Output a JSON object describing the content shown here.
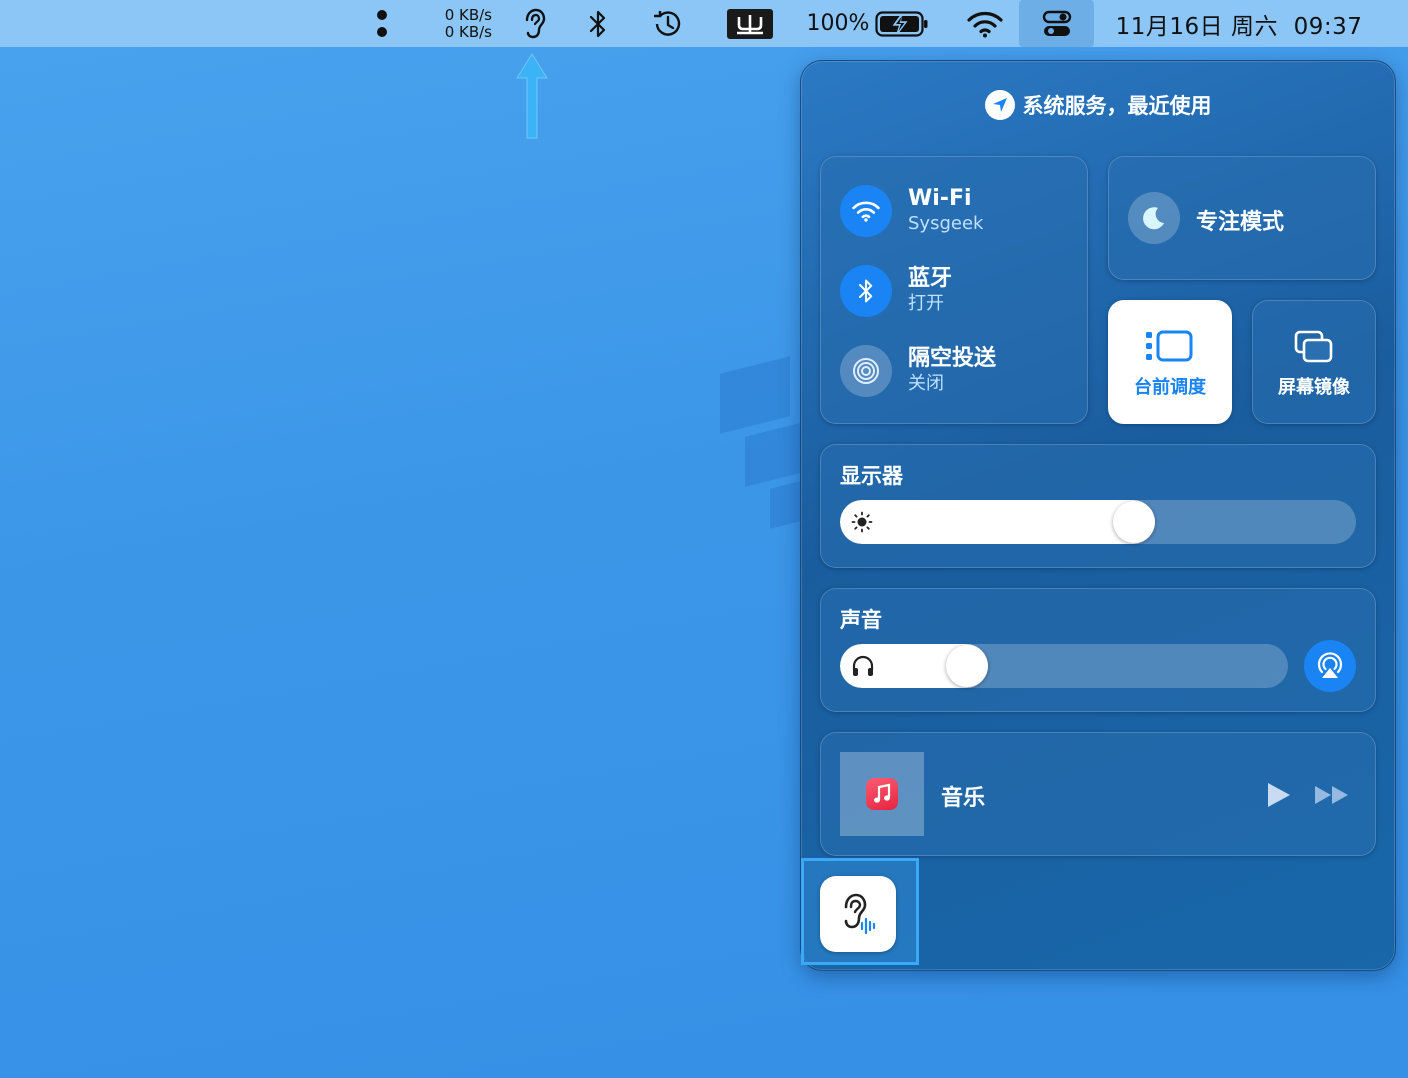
{
  "menubar": {
    "net_up": "0 KB/s",
    "net_down": "0 KB/s",
    "battery_percent": "100%",
    "datetime": "11月16日 周六  09:37",
    "icons": [
      "dots-icon",
      "hearing-icon",
      "bluetooth-icon",
      "time-machine-icon",
      "input-method-icon",
      "battery-charging-icon",
      "wifi-icon",
      "control-center-icon"
    ]
  },
  "control_center": {
    "location_text": "系统服务，最近使用",
    "wifi": {
      "title": "Wi-Fi",
      "subtitle": "Sysgeek"
    },
    "bluetooth": {
      "title": "蓝牙",
      "subtitle": "打开"
    },
    "airdrop": {
      "title": "隔空投送",
      "subtitle": "关闭"
    },
    "focus": {
      "label": "专注模式"
    },
    "stage_manager": {
      "label": "台前调度",
      "active": true
    },
    "screen_mirroring": {
      "label": "屏幕镜像"
    },
    "display": {
      "title": "显示器",
      "brightness": 0.61
    },
    "sound": {
      "title": "声音",
      "volume": 0.33
    },
    "now_playing": {
      "app": "音乐"
    },
    "hearing_module": {
      "icon": "hearing-icon"
    }
  },
  "colors": {
    "accent_blue": "#1a84f5",
    "highlight": "#3ba9f5",
    "desktop": "#3c96e8"
  }
}
